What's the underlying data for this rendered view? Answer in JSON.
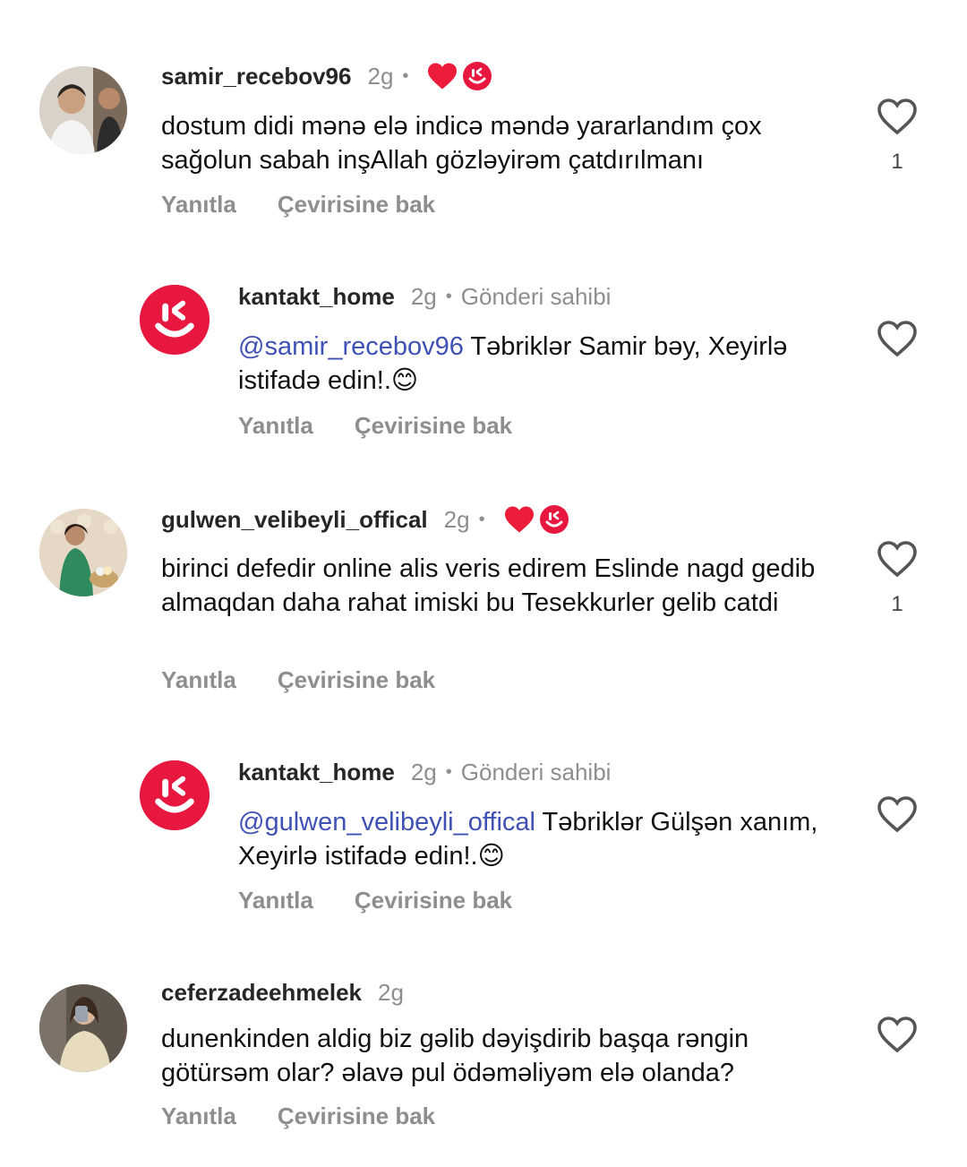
{
  "comments": [
    {
      "username": "samir_recebov96",
      "time": "2g",
      "text": "dostum didi mənə elə indicə məndə yararlandım çox sağolun sabah inşAllah gözləyirəm çatdırılmanı",
      "reply_label": "Yanıtla",
      "translate_label": "Çevirisine bak",
      "like_count": "1"
    },
    {
      "username": "kantakt_home",
      "time": "2g",
      "owner_label": "Gönderi sahibi",
      "mention": "@samir_recebov96",
      "text": " Təbriklər Samir bəy, Xeyirlə istifadə edin!.😊",
      "reply_label": "Yanıtla",
      "translate_label": "Çevirisine bak"
    },
    {
      "username": "gulwen_velibeyli_offical",
      "time": "2g",
      "text": "birinci defedir online alis veris edirem Eslinde nagd gedib almaqdan daha rahat imiski bu Tesekkurler gelib catdi",
      "reply_label": "Yanıtla",
      "translate_label": "Çevirisine bak",
      "like_count": "1"
    },
    {
      "username": "kantakt_home",
      "time": "2g",
      "owner_label": "Gönderi sahibi",
      "mention": "@gulwen_velibeyli_offical",
      "text": " Təbriklər Gülşən xanım, Xeyirlə istifadə edin!.😊",
      "reply_label": "Yanıtla",
      "translate_label": "Çevirisine bak"
    },
    {
      "username": "ceferzadeehmelek",
      "time": "2g",
      "text": "dunenkinden aldig biz gəlib dəyişdirib başqa rəngin götürsəm olar? əlavə pul ödəməliyəm elə olanda?",
      "reply_label": "Yanıtla",
      "translate_label": "Çevirisine bak"
    }
  ],
  "dot": "•",
  "colors": {
    "brand": "#e8173f",
    "heart": "#ed1c3a",
    "mention": "#3f51b5"
  }
}
